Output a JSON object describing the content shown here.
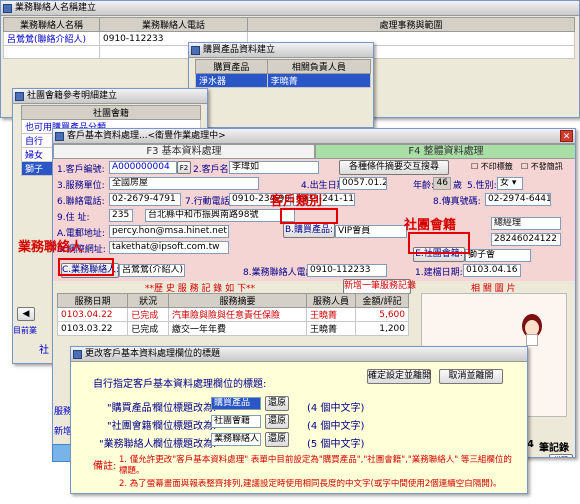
{
  "w1": {
    "title": "業務聯絡人名稱建立",
    "col1": "業務聯絡人名稱",
    "col2": "業務聯絡人電話",
    "col3": "處理事務與範圍",
    "row_name": "呂鶯鶯(聯絡介紹人)",
    "row_phone": "0910-112233"
  },
  "w2": {
    "title": "購買產品資料建立",
    "col1": "購買產品",
    "col2": "相關負責人員",
    "row_product": "淨水器",
    "row_person": "李曉菁"
  },
  "w3": {
    "title": "社團會籍參考明細建立",
    "col1": "社團會籍",
    "rows": [
      "也可用購買產品分類",
      "自行",
      "婦女",
      "獅子"
    ]
  },
  "main": {
    "title": "客戶基本資料處理...<衛豐作業處理中>",
    "tab1": "F3 基本資料處理",
    "tab2": "F4 整體資料處理",
    "client_no_label": "1.客戶編號:",
    "client_no": "A000000004",
    "f2": "F2",
    "name_label": "2.客戶名稱:",
    "name": "李瑋如",
    "print_btn": "各種條件摘要交互搜尋",
    "chk1": "不印標籤",
    "chk2": "不發簡訊",
    "unit_label": "3.服務單位:",
    "unit": "全國房屋",
    "birth_label": "4.出生日期:",
    "birth": "0057.01.26",
    "age_label": "年齡:",
    "age": "46",
    "age_unit": "歲",
    "sex_label": "5.性別:",
    "sex": "女",
    "phone_label": "6.聯絡電話:",
    "phone": "02-2679-4791",
    "mobile_label": "7.行動電話:",
    "mobile": "0910-234-901",
    "mobile2": "0933-241-112",
    "fax_label": "8.傳真號碼:",
    "fax": "02-2974-6441",
    "addr_label": "9.住    址:",
    "zip": "235",
    "addr": "台北縣中和市振興南路98號",
    "email_label": "A.電郵地址:",
    "email": "percy.hon@msa.hinet.net",
    "web_label": "D.網際網址:",
    "web": "takethat@ipsoft.com.tw",
    "product_btn": "B.購買產品:",
    "product": "VIP會員",
    "title_val": "總經理",
    "tax": "28246024122",
    "club_label": "E.社團會籍:",
    "club": "獅子會",
    "contact_label": "C.業務聯絡人:",
    "contact": "呂鶯鶯(介紹人)",
    "contact_phone_label": "8.業務聯絡人電話:",
    "contact_phone": "0910-112233",
    "build_label": "1.建檔日期:",
    "build_date": "0103.04.16",
    "history_title": "**歷 史 服 務 記 錄 如 下**",
    "new_record": "新增一筆服務記錄",
    "photo_title": "相 關 圖 片",
    "h_cols": [
      "服務日期",
      "狀況",
      "服務摘要",
      "服務人員",
      "金額/評記"
    ],
    "history": [
      {
        "date": "0103.04.22",
        "status": "已完成",
        "summary": "汽車險與險與任意責任保險",
        "staff": "王曉菁",
        "amount": "5,600"
      },
      {
        "date": "0103.03.22",
        "status": "已完成",
        "summary": "繳交一年年費",
        "staff": "王曉菁",
        "amount": "1,200"
      }
    ],
    "record_count": "4",
    "record_label": "筆記錄",
    "help": "說明"
  },
  "side": {
    "list_label": "目前業",
    "prev": "◀",
    "bottom": "社",
    "svc": "服務",
    "new": "新增"
  },
  "ann": {
    "category": "客戶類別",
    "club": "社團會籍",
    "contact": "業務聯絡人"
  },
  "dialog": {
    "title": "更改客戶基本資料處理欄位的標題",
    "intro": "自行指定客戶基本資料處理欄位的標題:",
    "confirm": "確定設定並離開",
    "cancel": "取消並離開",
    "rows": [
      {
        "name": "\"購買產品\"",
        "mid": "欄位標題改為:",
        "val": "購買產品",
        "btn": "還原",
        "note": "(4 個中文字)"
      },
      {
        "name": "\"社團會籍\"",
        "mid": "欄位標題改為:",
        "val": "社團會籍",
        "btn": "還原",
        "note": "(4 個中文字)"
      },
      {
        "name": "\"業務聯絡人\"",
        "mid": "欄位標題改為:",
        "val": "業務聯絡人",
        "btn": "還原",
        "note": "(5 個中文字)"
      }
    ],
    "note_label": "備註:",
    "note1": "1. 僅允許更改\"客戶基本資料處理\" 表單中目前設定為\"購買產品\",\"社團會籍\",\"業務聯絡人\" 等三組欄位的標題。",
    "note2": "2. 為了螢幕畫面與報表整齊排列,建議設定時使用相同長度的中文字(或字中間使用2個連續空白隔開)。"
  }
}
